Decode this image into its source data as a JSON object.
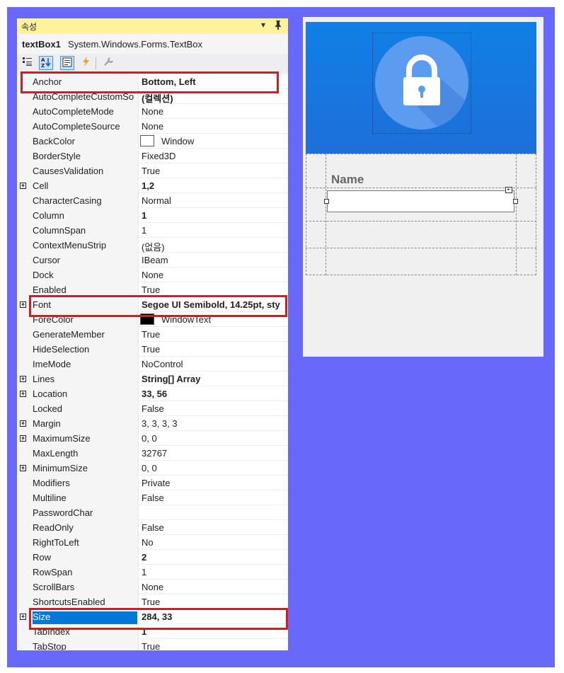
{
  "panel": {
    "title": "속성",
    "dropdown_icon": "▾",
    "pin_icon": "ᵖ",
    "object_name": "textBox1",
    "object_class": "System.Windows.Forms.TextBox"
  },
  "toolbar": {
    "categorized_icon": "categorized-icon",
    "alphabetical_icon": "alphabetical-icon",
    "properties_icon": "properties-icon",
    "events_icon": "lightning-icon",
    "property_pages_icon": "wrench-icon"
  },
  "properties": [
    {
      "name": "Anchor",
      "value": "Bottom, Left",
      "bold": true
    },
    {
      "name": "AutoCompleteCustomSo",
      "value": "(컬렉션)",
      "bold": true
    },
    {
      "name": "AutoCompleteMode",
      "value": "None"
    },
    {
      "name": "AutoCompleteSource",
      "value": "None"
    },
    {
      "name": "BackColor",
      "value": "Window",
      "swatch": "#ffffff"
    },
    {
      "name": "BorderStyle",
      "value": "Fixed3D"
    },
    {
      "name": "CausesValidation",
      "value": "True"
    },
    {
      "name": "Cell",
      "value": "1,2",
      "bold": true,
      "expandable": true
    },
    {
      "name": "CharacterCasing",
      "value": "Normal"
    },
    {
      "name": "Column",
      "value": "1",
      "bold": true
    },
    {
      "name": "ColumnSpan",
      "value": "1"
    },
    {
      "name": "ContextMenuStrip",
      "value": "(없음)"
    },
    {
      "name": "Cursor",
      "value": "IBeam"
    },
    {
      "name": "Dock",
      "value": "None"
    },
    {
      "name": "Enabled",
      "value": "True"
    },
    {
      "name": "Font",
      "value": "Segoe UI Semibold, 14.25pt, sty",
      "bold": true,
      "expandable": true
    },
    {
      "name": "ForeColor",
      "value": "WindowText",
      "swatch": "#000000"
    },
    {
      "name": "GenerateMember",
      "value": "True"
    },
    {
      "name": "HideSelection",
      "value": "True"
    },
    {
      "name": "ImeMode",
      "value": "NoControl"
    },
    {
      "name": "Lines",
      "value": "String[] Array",
      "bold": true,
      "expandable": true
    },
    {
      "name": "Location",
      "value": "33, 56",
      "bold": true,
      "expandable": true
    },
    {
      "name": "Locked",
      "value": "False"
    },
    {
      "name": "Margin",
      "value": "3, 3, 3, 3",
      "expandable": true
    },
    {
      "name": "MaximumSize",
      "value": "0, 0",
      "expandable": true
    },
    {
      "name": "MaxLength",
      "value": "32767"
    },
    {
      "name": "MinimumSize",
      "value": "0, 0",
      "expandable": true
    },
    {
      "name": "Modifiers",
      "value": "Private"
    },
    {
      "name": "Multiline",
      "value": "False"
    },
    {
      "name": "PasswordChar",
      "value": ""
    },
    {
      "name": "ReadOnly",
      "value": "False"
    },
    {
      "name": "RightToLeft",
      "value": "No"
    },
    {
      "name": "Row",
      "value": "2",
      "bold": true
    },
    {
      "name": "RowSpan",
      "value": "1"
    },
    {
      "name": "ScrollBars",
      "value": "None"
    },
    {
      "name": "ShortcutsEnabled",
      "value": "True"
    },
    {
      "name": "Size",
      "value": "284, 33",
      "bold": true,
      "expandable": true,
      "selected": true
    },
    {
      "name": "TabIndex",
      "value": "1",
      "bold": true
    },
    {
      "name": "TabStop",
      "value": "True"
    }
  ],
  "highlights": [
    "Anchor",
    "Font",
    "Size"
  ],
  "designer": {
    "name_label": "Name",
    "banner_color": "#1075e0",
    "lock_icon": "lock-icon"
  }
}
